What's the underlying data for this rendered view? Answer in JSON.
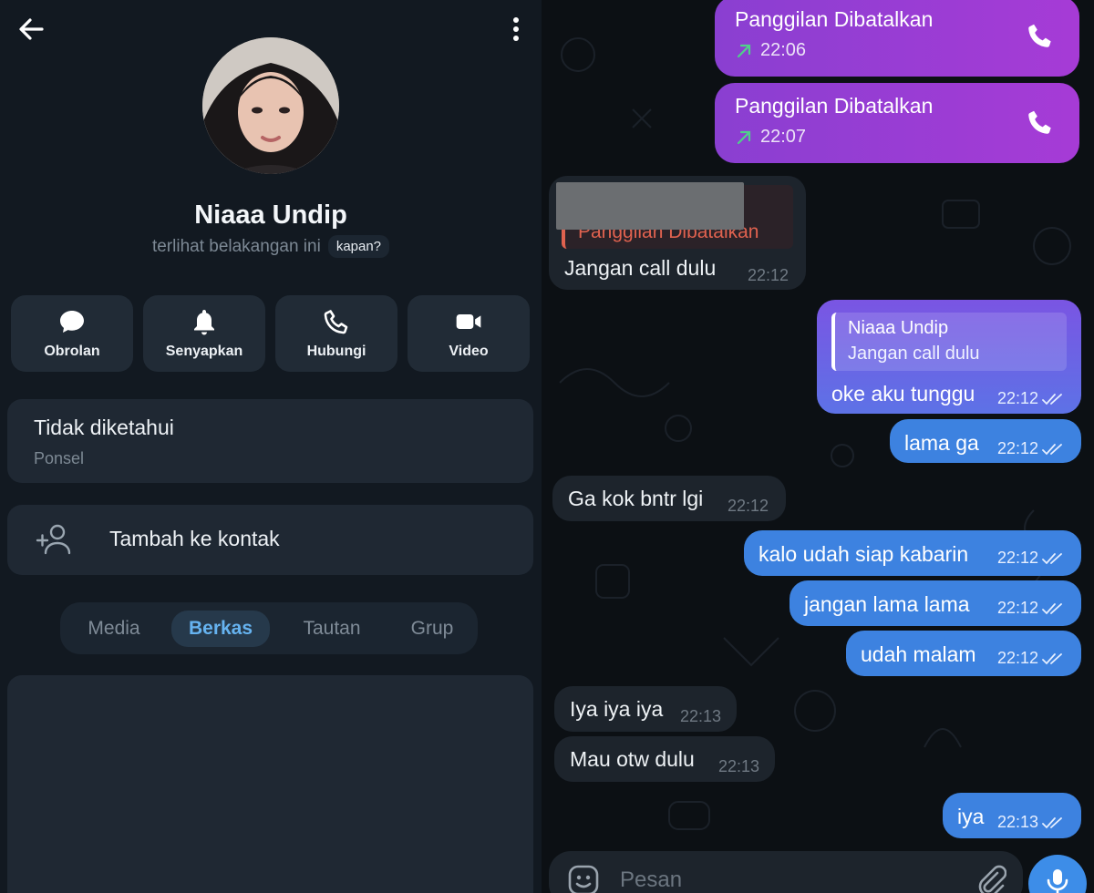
{
  "profile": {
    "name": "Niaaa Undip",
    "status_text": "terlihat belakangan ini",
    "status_chip": "kapan?",
    "actions": [
      {
        "label": "Obrolan",
        "icon": "chat-bubble-icon"
      },
      {
        "label": "Senyapkan",
        "icon": "bell-icon"
      },
      {
        "label": "Hubungi",
        "icon": "phone-icon"
      },
      {
        "label": "Video",
        "icon": "video-camera-icon"
      }
    ],
    "phone": {
      "value": "Tidak diketahui",
      "label": "Ponsel"
    },
    "add_contact": "Tambah ke kontak",
    "tabs": [
      "Media",
      "Berkas",
      "Tautan",
      "Grup"
    ],
    "active_tab": "Berkas"
  },
  "chat": {
    "calls": [
      {
        "title": "Panggilan Dibatalkan",
        "time": "22:06"
      },
      {
        "title": "Panggilan Dibatalkan",
        "time": "22:07"
      }
    ],
    "quoted_incoming": {
      "quoted_title": "Panggilan Dibatalkan",
      "text": "Jangan call dulu",
      "time": "22:12"
    },
    "reply_outgoing": {
      "reply_name": "Niaaa Undip",
      "reply_text": "Jangan call dulu",
      "text": "oke aku tunggu",
      "time": "22:12"
    },
    "messages": [
      {
        "dir": "out",
        "text": "lama ga",
        "time": "22:12"
      },
      {
        "dir": "in",
        "text": "Ga kok bntr lgi",
        "time": "22:12"
      },
      {
        "dir": "out",
        "text": "kalo udah siap kabarin",
        "time": "22:12"
      },
      {
        "dir": "out",
        "text": "jangan lama lama",
        "time": "22:12"
      },
      {
        "dir": "out",
        "text": "udah malam",
        "time": "22:12"
      },
      {
        "dir": "in",
        "text": "Iya iya iya",
        "time": "22:13"
      },
      {
        "dir": "in",
        "text": "Mau otw dulu",
        "time": "22:13"
      },
      {
        "dir": "out",
        "text": "iya",
        "time": "22:13"
      }
    ],
    "composer_placeholder": "Pesan"
  },
  "colors": {
    "outgoing_bubble": "#3d82e0",
    "call_bubble": "#9a3dd4",
    "incoming_bubble": "#1d242c",
    "accent_tab": "#66b3f0"
  }
}
